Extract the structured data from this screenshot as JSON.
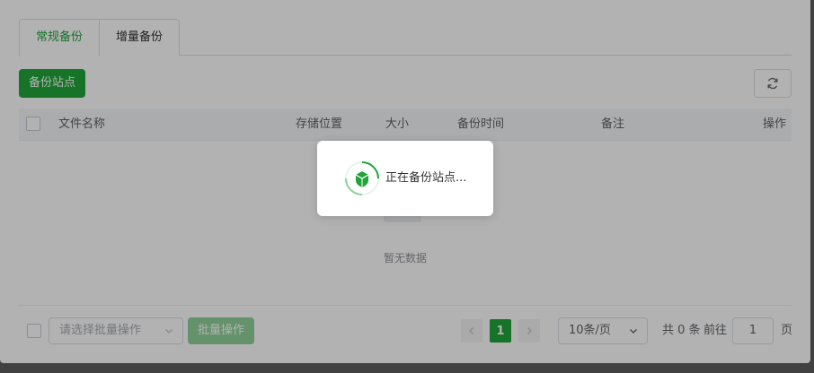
{
  "tabs": [
    {
      "label": "常规备份",
      "active": true
    },
    {
      "label": "增量备份",
      "active": false
    }
  ],
  "toolbar": {
    "backup_site_label": "备份站点"
  },
  "table": {
    "columns": [
      "文件名称",
      "存储位置",
      "大小",
      "备份时间",
      "备注",
      "操作"
    ],
    "rows": [],
    "empty_text": "暂无数据"
  },
  "footer": {
    "batch_placeholder": "请选择批量操作",
    "batch_button": "批量操作",
    "current_page": "1",
    "page_size": "10条/页",
    "total_text": "共 0 条",
    "goto_label": "前往",
    "goto_value": "1",
    "page_suffix": "页"
  },
  "loading": {
    "message": "正在备份站点..."
  },
  "colors": {
    "accent": "#20a53a"
  },
  "icons": {
    "refresh": "refresh-icon",
    "shield": "shield-icon"
  }
}
